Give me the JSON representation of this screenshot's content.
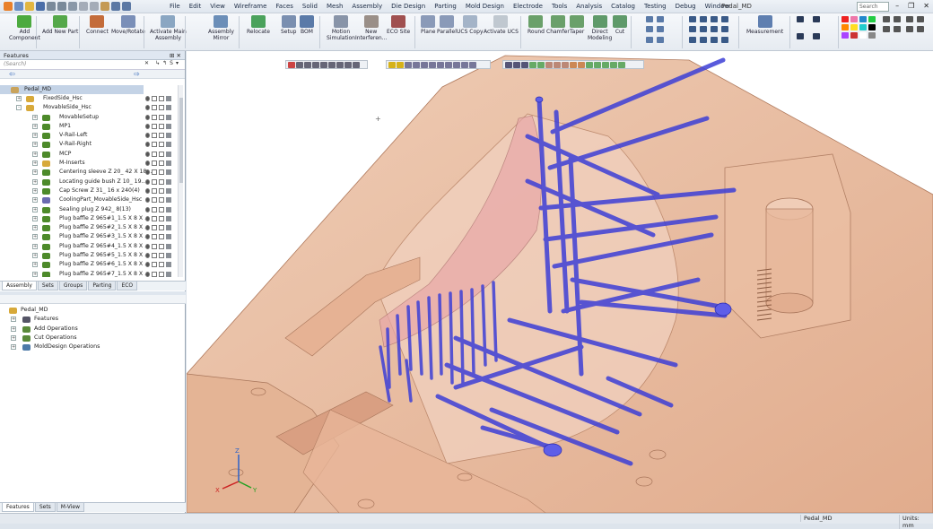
{
  "titlebar": {
    "menu": [
      "File",
      "Edit",
      "View",
      "Wireframe",
      "Faces",
      "Solid",
      "Mesh",
      "Assembly",
      "Die Design",
      "Parting",
      "Mold Design",
      "Electrode",
      "Tools",
      "Analysis",
      "Catalog",
      "Testing",
      "Debug",
      "Window"
    ],
    "document_title": "Pedal_MD",
    "search_placeholder": "Search"
  },
  "ribbon": {
    "buttons": [
      {
        "id": "add-component",
        "label": "Add\nComponent"
      },
      {
        "id": "add-new-part",
        "label": "Add New Part"
      },
      {
        "id": "connect",
        "label": "Connect"
      },
      {
        "id": "move-rotate",
        "label": "Move/Rotate"
      },
      {
        "id": "activate-main-assembly",
        "label": "Activate Main\nAssembly"
      },
      {
        "id": "assembly-mirror",
        "label": "Assembly\nMirror"
      },
      {
        "id": "relocate",
        "label": "Relocate"
      },
      {
        "id": "setup",
        "label": "Setup"
      },
      {
        "id": "bom",
        "label": "BOM"
      },
      {
        "id": "motion-simulation",
        "label": "Motion\nSimulation"
      },
      {
        "id": "new-interference",
        "label": "New\nInterferen..."
      },
      {
        "id": "eco-site",
        "label": "ECO Site"
      },
      {
        "id": "plane",
        "label": "Plane"
      },
      {
        "id": "parallel",
        "label": "Parallel"
      },
      {
        "id": "ucs-copy",
        "label": "UCS Copy"
      },
      {
        "id": "activate-ucs",
        "label": "Activate UCS"
      },
      {
        "id": "round",
        "label": "Round"
      },
      {
        "id": "chamfer",
        "label": "Chamfer"
      },
      {
        "id": "taper",
        "label": "Taper"
      },
      {
        "id": "direct-modeling",
        "label": "Direct\nModeling"
      },
      {
        "id": "cut",
        "label": "Cut"
      },
      {
        "id": "measurement",
        "label": "Measurement"
      }
    ]
  },
  "features_panel": {
    "title": "Features",
    "search_placeholder": "(Search)",
    "root": "Pedal_MD",
    "items": [
      {
        "label": "FixedSide_Hsc",
        "level": 1,
        "icon": "assembly-icon",
        "expand": "+"
      },
      {
        "label": "MovableSide_Hsc",
        "level": 1,
        "icon": "assembly-icon",
        "expand": "-"
      },
      {
        "label": "MovableSetup",
        "level": 2,
        "icon": "part-icon",
        "expand": "+"
      },
      {
        "label": "MP1",
        "level": 2,
        "icon": "part-icon",
        "expand": "+"
      },
      {
        "label": "V-Rail-Left",
        "level": 2,
        "icon": "part-icon",
        "expand": "+"
      },
      {
        "label": "V-Rail-Right",
        "level": 2,
        "icon": "part-icon",
        "expand": "+"
      },
      {
        "label": "MCP",
        "level": 2,
        "icon": "part-icon",
        "expand": "+"
      },
      {
        "label": "M-Inserts",
        "level": 2,
        "icon": "assembly-icon",
        "expand": "+"
      },
      {
        "label": "Centering sleeve Z 20_ 42 X 18...",
        "level": 2,
        "icon": "part-icon",
        "expand": "+"
      },
      {
        "label": "Locating guide bush Z 10_ 19...",
        "level": 2,
        "icon": "part-icon",
        "expand": "+"
      },
      {
        "label": "Cap Screw Z 31_ 16 x 240(4)",
        "level": 2,
        "icon": "part-icon",
        "expand": "+"
      },
      {
        "label": "CoolingPart_MovableSide_Hsc",
        "level": 2,
        "icon": "cooling-icon",
        "expand": "+"
      },
      {
        "label": "Sealing plug Z 942_ 8(13)",
        "level": 2,
        "icon": "part-icon",
        "expand": "+"
      },
      {
        "label": "Plug baffle Z 965#1_1.5 X 8 X ...",
        "level": 2,
        "icon": "part-icon",
        "expand": "+"
      },
      {
        "label": "Plug baffle Z 965#2_1.5 X 8 X ...",
        "level": 2,
        "icon": "part-icon",
        "expand": "+"
      },
      {
        "label": "Plug baffle Z 965#3_1.5 X 8 X ...",
        "level": 2,
        "icon": "part-icon",
        "expand": "+"
      },
      {
        "label": "Plug baffle Z 965#4_1.5 X 8 X ...",
        "level": 2,
        "icon": "part-icon",
        "expand": "+"
      },
      {
        "label": "Plug baffle Z 965#5_1.5 X 8 X ...",
        "level": 2,
        "icon": "part-icon",
        "expand": "+"
      },
      {
        "label": "Plug baffle Z 965#6_1.5 X 8 X ...",
        "level": 2,
        "icon": "part-icon",
        "expand": "+"
      },
      {
        "label": "Plug baffle Z 965#7_1.5 X 8 X ...",
        "level": 2,
        "icon": "part-icon",
        "expand": "+"
      }
    ],
    "tabs": [
      "Assembly",
      "Sets",
      "Groups",
      "Parting",
      "ECO"
    ]
  },
  "operations_panel": {
    "root": "Pedal_MD",
    "items": [
      "Features",
      "Add Operations",
      "Cut Operations",
      "MoldDesign Operations"
    ]
  },
  "bottom_tabs": [
    "Features",
    "Sets",
    "M-View"
  ],
  "viewport": {
    "axes": {
      "x": "X",
      "y": "Y",
      "z": "Z"
    }
  },
  "statusbar": {
    "document": "Pedal_MD",
    "units": "Units: mm"
  },
  "colors": {
    "mold": "#e9bda1",
    "cooling": "#3d3fd6",
    "accent": "#2c5aa0"
  }
}
